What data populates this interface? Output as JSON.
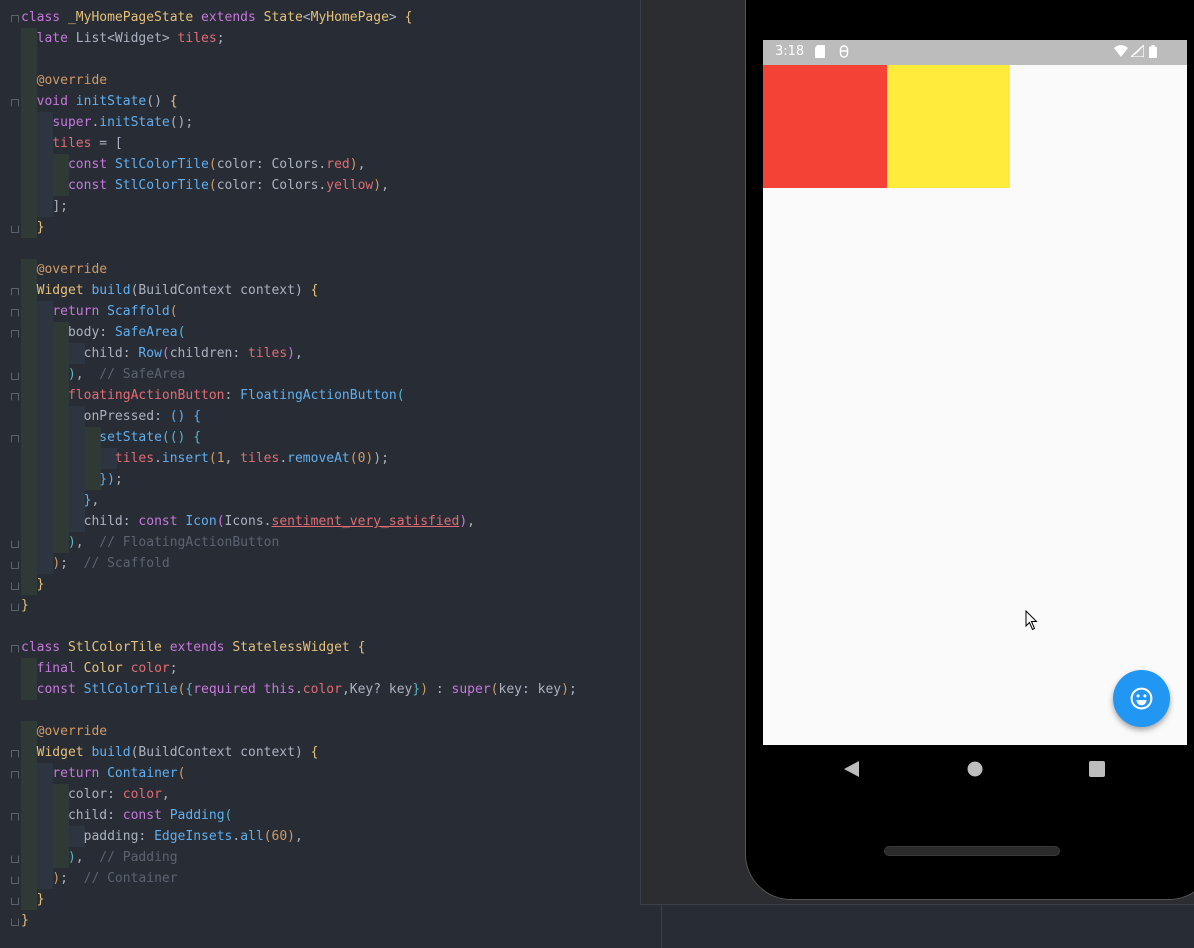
{
  "editor": {
    "lines": [
      [
        [
          "k",
          "class "
        ],
        [
          "t",
          "_MyHomePageState "
        ],
        [
          "k",
          "extends "
        ],
        [
          "t",
          "State"
        ],
        [
          "p",
          "<"
        ],
        [
          "t",
          "MyHomePage"
        ],
        [
          "p",
          "> "
        ],
        [
          "t",
          "{"
        ]
      ],
      [
        [
          "k",
          "late "
        ],
        [
          "p",
          "List<Widget> "
        ],
        [
          "fld",
          "tiles"
        ],
        [
          "p",
          ";"
        ]
      ],
      [],
      [
        [
          "n",
          "@override"
        ]
      ],
      [
        [
          "k",
          "void "
        ],
        [
          "f",
          "initState"
        ],
        [
          "p",
          "() "
        ],
        [
          "t",
          "{"
        ]
      ],
      [
        [
          "k",
          "super"
        ],
        [
          "p",
          "."
        ],
        [
          "f",
          "initState"
        ],
        [
          "p",
          "();"
        ]
      ],
      [
        [
          "fld",
          "tiles"
        ],
        [
          "p",
          " = ["
        ]
      ],
      [
        [
          "k",
          "const "
        ],
        [
          "f",
          "StlColorTile"
        ],
        [
          "n",
          "("
        ],
        [
          "p",
          "color: Colors."
        ],
        [
          "fld",
          "red"
        ],
        [
          "n",
          ")"
        ],
        [
          "p",
          ","
        ]
      ],
      [
        [
          "k",
          "const "
        ],
        [
          "f",
          "StlColorTile"
        ],
        [
          "n",
          "("
        ],
        [
          "p",
          "color: Colors."
        ],
        [
          "fld",
          "yellow"
        ],
        [
          "n",
          ")"
        ],
        [
          "p",
          ","
        ]
      ],
      [
        [
          "p",
          "];"
        ]
      ],
      [
        [
          "t",
          "}"
        ]
      ],
      [],
      [
        [
          "n",
          "@override"
        ]
      ],
      [
        [
          "t",
          "Widget "
        ],
        [
          "f",
          "build"
        ],
        [
          "p",
          "(BuildContext context) "
        ],
        [
          "t",
          "{"
        ]
      ],
      [
        [
          "k",
          "return "
        ],
        [
          "f",
          "Scaffold"
        ],
        [
          "n",
          "("
        ]
      ],
      [
        [
          "p",
          "body: "
        ],
        [
          "f",
          "SafeArea"
        ],
        [
          "fgc",
          "("
        ]
      ],
      [
        [
          "p",
          "child: "
        ],
        [
          "f",
          "Row"
        ],
        [
          "k",
          "("
        ],
        [
          "p",
          "children: "
        ],
        [
          "fld",
          "tiles"
        ],
        [
          "k",
          ")"
        ],
        [
          "p",
          ","
        ]
      ],
      [
        [
          "fgc",
          ")"
        ],
        [
          "p",
          ",  "
        ],
        [
          "c",
          "// SafeArea"
        ]
      ],
      [
        [
          "fld",
          "floatingActionButton"
        ],
        [
          "p",
          ": "
        ],
        [
          "f",
          "FloatingActionButton"
        ],
        [
          "fgc",
          "("
        ]
      ],
      [
        [
          "p",
          "onPressed: "
        ],
        [
          "f",
          "() {"
        ]
      ],
      [
        [
          "f",
          "setState"
        ],
        [
          "fgc",
          "(() {"
        ]
      ],
      [
        [
          "fld",
          "tiles"
        ],
        [
          "p",
          "."
        ],
        [
          "f",
          "insert"
        ],
        [
          "n",
          "("
        ],
        [
          "n",
          "1"
        ],
        [
          "p",
          ", "
        ],
        [
          "fld",
          "tiles"
        ],
        [
          "p",
          "."
        ],
        [
          "f",
          "removeAt"
        ],
        [
          "n",
          "("
        ],
        [
          "n",
          "0"
        ],
        [
          "n",
          ")"
        ],
        [
          "p",
          ");"
        ]
      ],
      [
        [
          "f",
          "})"
        ],
        [
          "p",
          ";"
        ]
      ],
      [
        [
          "f",
          "}"
        ],
        [
          "p",
          ","
        ]
      ],
      [
        [
          "p",
          "child: "
        ],
        [
          "k",
          "const "
        ],
        [
          "f",
          "Icon"
        ],
        [
          "k",
          "("
        ],
        [
          "p",
          "Icons."
        ],
        [
          "u",
          "sentiment_very_satisfied"
        ],
        [
          "k",
          ")"
        ],
        [
          "p",
          ","
        ]
      ],
      [
        [
          "fgc",
          ")"
        ],
        [
          "p",
          ",  "
        ],
        [
          "c",
          "// FloatingActionButton"
        ]
      ],
      [
        [
          "n",
          ")"
        ],
        [
          "p",
          ";  "
        ],
        [
          "c",
          "// Scaffold"
        ]
      ],
      [
        [
          "t",
          "}"
        ]
      ],
      [
        [
          "t",
          "}"
        ]
      ],
      [],
      [
        [
          "k",
          "class "
        ],
        [
          "t",
          "StlColorTile "
        ],
        [
          "k",
          "extends "
        ],
        [
          "t",
          "StatelessWidget "
        ],
        [
          "t",
          "{"
        ]
      ],
      [
        [
          "k",
          "final "
        ],
        [
          "t",
          "Color "
        ],
        [
          "fld",
          "color"
        ],
        [
          "p",
          ";"
        ]
      ],
      [
        [
          "k",
          "const "
        ],
        [
          "f",
          "StlColorTile"
        ],
        [
          "n",
          "("
        ],
        [
          "fgc",
          "{"
        ],
        [
          "k",
          "required "
        ],
        [
          "k",
          "this"
        ],
        [
          "p",
          "."
        ],
        [
          "fld",
          "color"
        ],
        [
          "p",
          ",Key? key"
        ],
        [
          "fgc",
          "}"
        ],
        [
          "n",
          ")"
        ],
        [
          "p",
          " : "
        ],
        [
          "k",
          "super"
        ],
        [
          "n",
          "("
        ],
        [
          "p",
          "key: key"
        ],
        [
          "n",
          ")"
        ],
        [
          "p",
          ";"
        ]
      ],
      [],
      [
        [
          "n",
          "@override"
        ]
      ],
      [
        [
          "t",
          "Widget "
        ],
        [
          "f",
          "build"
        ],
        [
          "p",
          "(BuildContext context) "
        ],
        [
          "t",
          "{"
        ]
      ],
      [
        [
          "k",
          "return "
        ],
        [
          "f",
          "Container"
        ],
        [
          "n",
          "("
        ]
      ],
      [
        [
          "p",
          "color: "
        ],
        [
          "fld",
          "color"
        ],
        [
          "p",
          ","
        ]
      ],
      [
        [
          "p",
          "child: "
        ],
        [
          "k",
          "const "
        ],
        [
          "f",
          "Padding"
        ],
        [
          "fgc",
          "("
        ]
      ],
      [
        [
          "p",
          "padding: "
        ],
        [
          "f",
          "EdgeInsets"
        ],
        [
          "p",
          "."
        ],
        [
          "f",
          "all"
        ],
        [
          "n",
          "("
        ],
        [
          "n",
          "60"
        ],
        [
          "n",
          ")"
        ],
        [
          "p",
          ","
        ]
      ],
      [
        [
          "fgc",
          ")"
        ],
        [
          "p",
          ",  "
        ],
        [
          "c",
          "// Padding"
        ]
      ],
      [
        [
          "n",
          ")"
        ],
        [
          "p",
          ";  "
        ],
        [
          "c",
          "// Container"
        ]
      ],
      [
        [
          "t",
          "}"
        ]
      ],
      [
        [
          "t",
          "}"
        ]
      ]
    ]
  },
  "phone": {
    "status_time": "3:18",
    "tiles": [
      {
        "name": "red",
        "color": "#f44336"
      },
      {
        "name": "yellow",
        "color": "#ffeb3b"
      }
    ],
    "fab_color": "#2196f3",
    "fab_icon": "sentiment-very-satisfied-icon"
  }
}
